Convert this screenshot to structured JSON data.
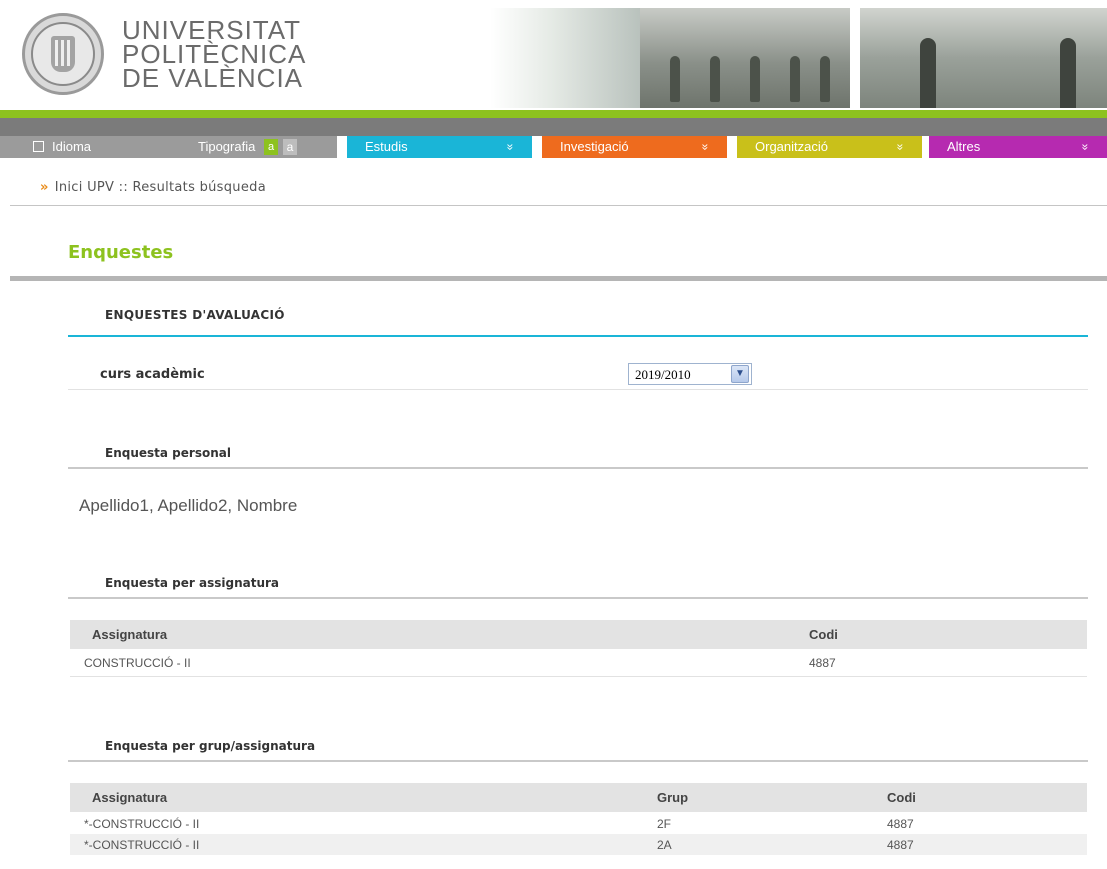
{
  "header": {
    "logo_line1": "UNIVERSITAT",
    "logo_line2": "POLITÈCNICA",
    "logo_line3": "DE VALÈNCIA",
    "logo_icon": "upv-seal-icon"
  },
  "nav": {
    "idioma": "Idioma",
    "tipografia": "Tipografia",
    "font_a1": "a",
    "font_a2": "a",
    "items": [
      {
        "label": "Estudis",
        "color": "#1ab5d7"
      },
      {
        "label": "Investigació",
        "color": "#ee6b1e"
      },
      {
        "label": "Organització",
        "color": "#c9c01a"
      },
      {
        "label": "Altres",
        "color": "#b62ab0"
      }
    ],
    "chevron": "»"
  },
  "breadcrumb": {
    "arrow": "»",
    "text": "Inici UPV :: Resultats búsqueda"
  },
  "page_title": "Enquestes",
  "section_title": "ENQUESTES D'AVALUACIÓ",
  "curs": {
    "label": "curs acadèmic",
    "selected": "2019/2010"
  },
  "personal": {
    "title": "Enquesta personal",
    "name": "Apellido1, Apellido2, Nombre"
  },
  "per_assignatura": {
    "title": "Enquesta per assignatura",
    "headers": [
      "Assignatura",
      "Codi"
    ],
    "rows": [
      [
        "CONSTRUCCIÓ - II",
        "4887"
      ]
    ]
  },
  "per_grup": {
    "title": "Enquesta per grup/assignatura",
    "headers": [
      "Assignatura",
      "Grup",
      "Codi"
    ],
    "rows": [
      [
        "*-CONSTRUCCIÓ - II",
        "2F",
        "4887"
      ],
      [
        "*-CONSTRUCCIÓ - II",
        "2A",
        "4887"
      ]
    ]
  },
  "colors": {
    "accent_green": "#8dc21f",
    "accent_blue": "#1ab5d7"
  }
}
